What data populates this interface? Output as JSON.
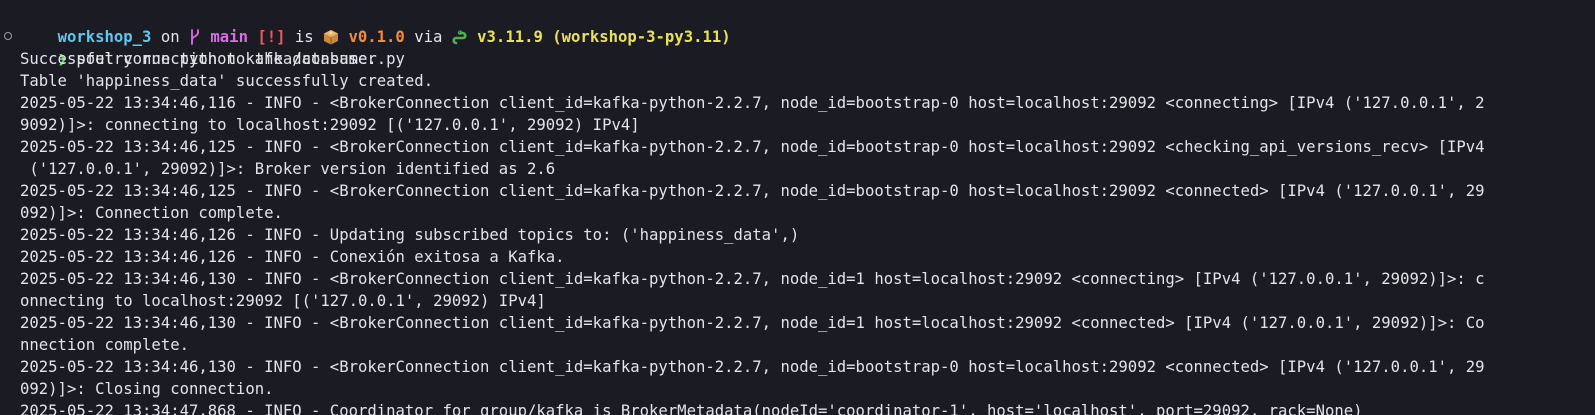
{
  "colors": {
    "background": "#1b1b23",
    "text": "#e3e3e8",
    "dir": "#5fc7f0",
    "branch": "#d86ee8",
    "status": "#f0595c",
    "version": "#f08c40",
    "python": "#e9e15a",
    "prompt": "#6ad56a"
  },
  "prompt_line": {
    "dir": "workshop_3",
    "on": " on ",
    "branch_icon": "git-branch-icon",
    "branch": " main",
    "status": " [!]",
    "is": " is ",
    "package_icon": "package-icon",
    "package_version": " v0.1.0",
    "via": " via ",
    "python_icon": "python-snake-icon",
    "python_version": " v3.11.9 (workshop-3-py3.11)"
  },
  "command_line": {
    "prompt_symbol": "❯",
    "command": " poetry run python kafka/consumer.py"
  },
  "output_lines": [
    "Successful connection to the database.",
    "Table 'happiness_data' successfully created.",
    "2025-05-22 13:34:46,116 - INFO - <BrokerConnection client_id=kafka-python-2.2.7, node_id=bootstrap-0 host=localhost:29092 <connecting> [IPv4 ('127.0.0.1', 2",
    "9092)]>: connecting to localhost:29092 [('127.0.0.1', 29092) IPv4]",
    "2025-05-22 13:34:46,125 - INFO - <BrokerConnection client_id=kafka-python-2.2.7, node_id=bootstrap-0 host=localhost:29092 <checking_api_versions_recv> [IPv4",
    " ('127.0.0.1', 29092)]>: Broker version identified as 2.6",
    "2025-05-22 13:34:46,125 - INFO - <BrokerConnection client_id=kafka-python-2.2.7, node_id=bootstrap-0 host=localhost:29092 <connected> [IPv4 ('127.0.0.1', 29",
    "092)]>: Connection complete.",
    "2025-05-22 13:34:46,126 - INFO - Updating subscribed topics to: ('happiness_data',)",
    "2025-05-22 13:34:46,126 - INFO - Conexión exitosa a Kafka.",
    "2025-05-22 13:34:46,130 - INFO - <BrokerConnection client_id=kafka-python-2.2.7, node_id=1 host=localhost:29092 <connecting> [IPv4 ('127.0.0.1', 29092)]>: c",
    "onnecting to localhost:29092 [('127.0.0.1', 29092) IPv4]",
    "2025-05-22 13:34:46,130 - INFO - <BrokerConnection client_id=kafka-python-2.2.7, node_id=1 host=localhost:29092 <connected> [IPv4 ('127.0.0.1', 29092)]>: Co",
    "nnection complete.",
    "2025-05-22 13:34:46,130 - INFO - <BrokerConnection client_id=kafka-python-2.2.7, node_id=bootstrap-0 host=localhost:29092 <connected> [IPv4 ('127.0.0.1', 29",
    "092)]>: Closing connection.",
    "2025-05-22 13:34:47,868 - INFO - Coordinator for group/kafka is BrokerMetadata(nodeId='coordinator-1', host='localhost', port=29092, rack=None)"
  ]
}
